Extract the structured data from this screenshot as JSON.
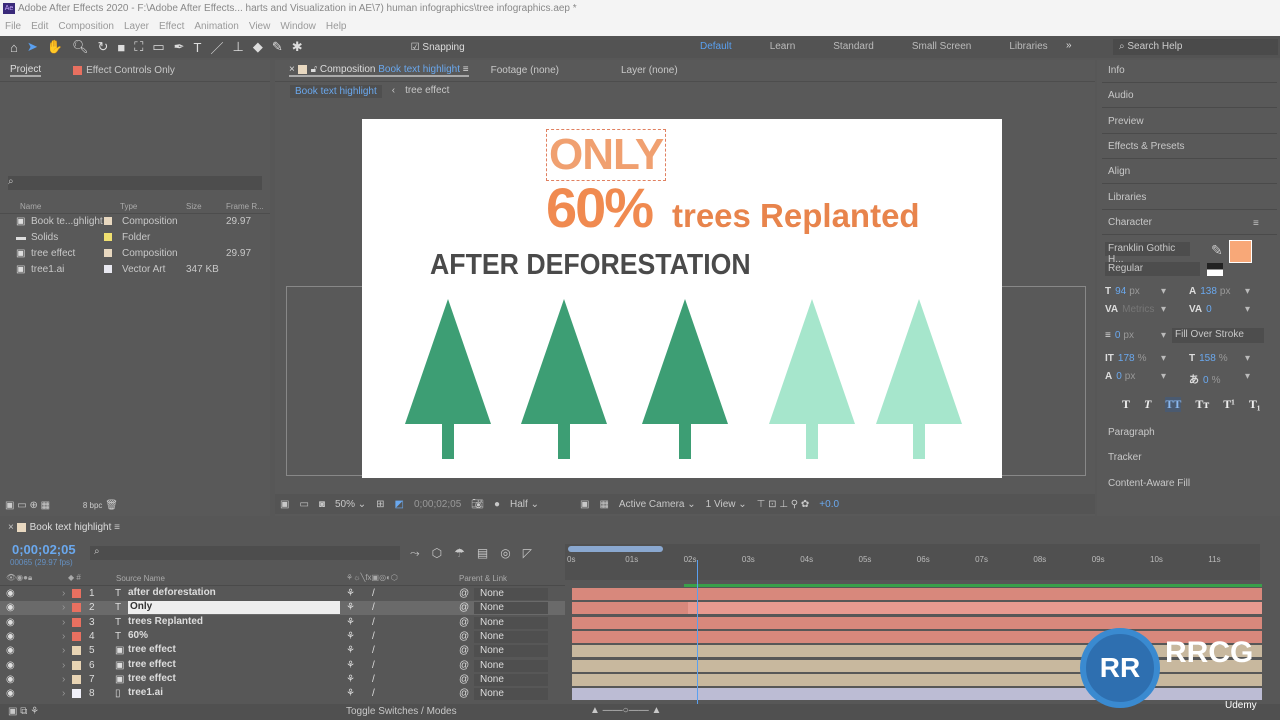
{
  "window": {
    "title": "Adobe After Effects 2020 - F:\\Adobe After Effects... harts and Visualization in AE\\7) human infographics\\tree infographics.aep *",
    "app_icon": "Ae"
  },
  "menu": [
    "File",
    "Edit",
    "Composition",
    "Layer",
    "Effect",
    "Animation",
    "View",
    "Window",
    "Help"
  ],
  "toolbar": {
    "tools": [
      "home-icon",
      "selection-icon",
      "hand-icon",
      "zoom-icon",
      "rotate-icon",
      "camera-icon",
      "pan-behind-icon",
      "rectangle-icon",
      "pen-icon",
      "type-icon",
      "brush-icon",
      "clone-stamp-icon",
      "eraser-icon",
      "roto-brush-icon",
      "puppet-icon"
    ],
    "snapping_label": "Snapping",
    "snapping_checked": true,
    "workspaces": [
      "Default",
      "Learn",
      "Standard",
      "Small Screen",
      "Libraries"
    ],
    "active_workspace": "Default",
    "more": "»",
    "search_placeholder": "Search Help"
  },
  "project": {
    "tab": "Project",
    "effect_controls": "Effect Controls Only",
    "columns": [
      "Name",
      "Type",
      "Size",
      "Frame R..."
    ],
    "items": [
      {
        "name": "Book te...ghlight",
        "type": "Composition",
        "size": "",
        "fps": "29.97",
        "color": "#e8d8c0"
      },
      {
        "name": "Solids",
        "type": "Folder",
        "size": "",
        "fps": "",
        "color": "#f0e070"
      },
      {
        "name": "tree effect",
        "type": "Composition",
        "size": "",
        "fps": "29.97",
        "color": "#e8d8c0"
      },
      {
        "name": "tree1.ai",
        "type": "Vector Art",
        "size": "347 KB",
        "fps": "",
        "color": "#e8e8f0"
      }
    ],
    "bpc": "8 bpc"
  },
  "comp": {
    "tab_prefix": "Composition",
    "tab_name": "Book text highlight",
    "footage": "Footage (none)",
    "layer": "Layer (none)",
    "breadcrumb": [
      "Book text highlight",
      "tree effect"
    ],
    "zoom": "50%",
    "timecode": "0;00;02;05",
    "resolution": "Half",
    "camera": "Active Camera",
    "views": "1 View",
    "exposure": "+0.0",
    "art": {
      "only": "ONLY",
      "percent": "60%",
      "replanted": "trees Replanted",
      "after": "AFTER DEFORESTATION",
      "orange": "#f08a50",
      "dark_green": "#3d9e74",
      "light_green": "#a6e6cc",
      "trees_dark": 3,
      "trees_light": 2
    }
  },
  "right": {
    "panels": [
      "Info",
      "Audio",
      "Preview",
      "Effects & Presets",
      "Align",
      "Libraries",
      "Character"
    ],
    "bottom_panels": [
      "Paragraph",
      "Tracker",
      "Content-Aware Fill"
    ],
    "character": {
      "font": "Franklin Gothic H...",
      "style": "Regular",
      "size": "94",
      "size_unit": "px",
      "leading": "138",
      "leading_unit": "px",
      "kerning": "Metrics",
      "tracking": "0",
      "stroke": "0",
      "stroke_unit": "px",
      "stroke_mode": "Fill Over Stroke",
      "vscale": "178",
      "hscale": "158",
      "baseline": "0",
      "baseline_unit": "px",
      "tsume": "0",
      "pct": "%",
      "fill_color": "#f8a878",
      "styles": [
        "T",
        "T",
        "TT",
        "Tт",
        "T¹",
        "T₁"
      ]
    }
  },
  "timeline": {
    "tab": "Book text highlight",
    "timecode": "0;00;02;05",
    "frames": "00065 (29.97 fps)",
    "columns": {
      "source": "Source Name",
      "parent": "Parent & Link"
    },
    "ticks": [
      "0s",
      "01s",
      "02s",
      "03s",
      "04s",
      "05s",
      "06s",
      "07s",
      "08s",
      "09s",
      "10s",
      "11s"
    ],
    "playhead_seconds": 2.2,
    "layers": [
      {
        "num": "1",
        "name": "after deforestation",
        "kind": "T",
        "color": "#e87060",
        "bar": "#d8887c",
        "parent": "None"
      },
      {
        "num": "2",
        "name": "Only",
        "kind": "T",
        "color": "#e87060",
        "bar": "#d8887c",
        "parent": "None",
        "selected": true
      },
      {
        "num": "3",
        "name": "trees Replanted",
        "kind": "T",
        "color": "#e87060",
        "bar": "#d8887c",
        "parent": "None"
      },
      {
        "num": "4",
        "name": "60%",
        "kind": "T",
        "color": "#e87060",
        "bar": "#d8887c",
        "parent": "None"
      },
      {
        "num": "5",
        "name": "tree effect",
        "kind": "comp",
        "color": "#e8d4b4",
        "bar": "#c8b89e",
        "parent": "None"
      },
      {
        "num": "6",
        "name": "tree effect",
        "kind": "comp",
        "color": "#e8d4b4",
        "bar": "#c8b89e",
        "parent": "None"
      },
      {
        "num": "7",
        "name": "tree effect",
        "kind": "comp",
        "color": "#e8d4b4",
        "bar": "#c8b89e",
        "parent": "None"
      },
      {
        "num": "8",
        "name": "tree1.ai",
        "kind": "ai",
        "color": "#f0f0f8",
        "bar": "#bcbcd4",
        "parent": "None"
      }
    ],
    "toggle_label": "Toggle Switches / Modes"
  },
  "watermark": {
    "text": "RRCG",
    "sub": "人人素材",
    "brand": "Udemy"
  }
}
